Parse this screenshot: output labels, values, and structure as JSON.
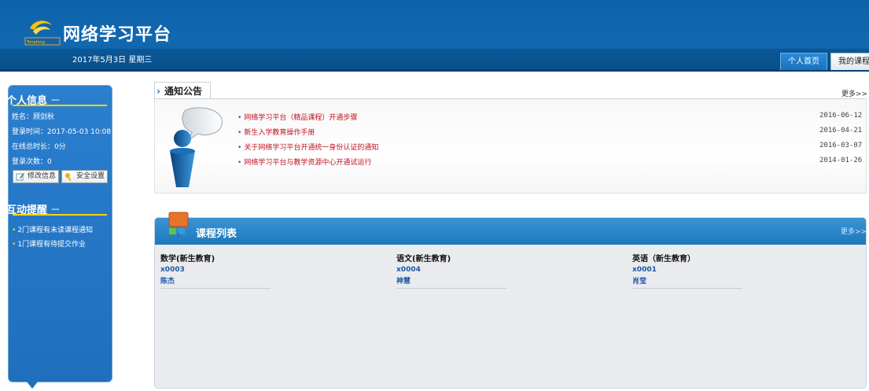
{
  "header": {
    "site_title": "网络学习平台",
    "date_text": "2017年5月3日 星期三",
    "logo_badge": "Tongfang",
    "tabs": [
      {
        "label": "个人首页"
      },
      {
        "label": "我的课程"
      }
    ]
  },
  "sidebar": {
    "personal_info": {
      "heading": "个人信息",
      "collapse_symbol": "－",
      "name": "姓名：顾剑秋",
      "login_time": "登录时间：2017-05-03 10:08",
      "online_total": "在线总时长：0分",
      "login_count": "登录次数：0",
      "edit_button": "修改信息",
      "security_button": "安全设置"
    },
    "reminders": {
      "heading": "互动提醒",
      "collapse_symbol": "－",
      "items": [
        {
          "label": "2门课程有未读课程通知"
        },
        {
          "label": "1门课程有待提交作业"
        }
      ]
    }
  },
  "notices": {
    "title": "通知公告",
    "arrow": "›",
    "more_label": "更多>>",
    "items": [
      {
        "title": "网络学习平台（精品课程）开通步骤",
        "date": "2016-06-12"
      },
      {
        "title": "新生入学教育操作手册",
        "date": "2016-04-21"
      },
      {
        "title": "关于网络学习平台开通统一身份认证的通知",
        "date": "2016-03-07"
      },
      {
        "title": "网络学习平台与教学资源中心开通试运行",
        "date": "2014-01-26"
      }
    ]
  },
  "courses": {
    "title": "课程列表",
    "more_label": "更多>>",
    "items": [
      {
        "name": "数学(新生教育)",
        "code": "x0003",
        "teacher": "陈杰"
      },
      {
        "name": "语文(新生教育)",
        "code": "x0004",
        "teacher": "神慧"
      },
      {
        "name": "英语（新生教育）",
        "code": "x0001",
        "teacher": "肖莹"
      }
    ]
  },
  "colors": {
    "header_blue": "#0c63aa",
    "sidebar_blue": "#2070bd",
    "accent_yellow": "#ffd400",
    "notice_red": "#c0141e",
    "link_blue": "#1d58a8"
  }
}
